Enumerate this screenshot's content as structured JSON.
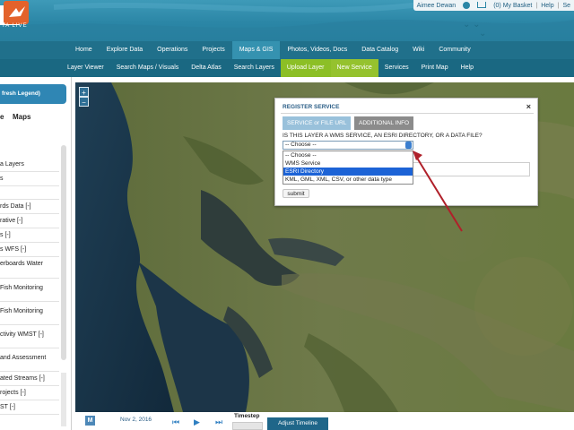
{
  "header": {
    "logo_text": "TA LIVE",
    "user_name": "Aimee Dewan",
    "basket_label": "(0) My Basket",
    "help_label": "Help",
    "search_label": "Se"
  },
  "nav_primary": [
    {
      "label": "Home"
    },
    {
      "label": "Explore Data"
    },
    {
      "label": "Operations"
    },
    {
      "label": "Projects"
    },
    {
      "label": "Maps & GIS"
    },
    {
      "label": "Photos, Videos, Docs"
    },
    {
      "label": "Data Catalog"
    },
    {
      "label": "Wiki"
    },
    {
      "label": "Community"
    }
  ],
  "nav_secondary": [
    {
      "label": "Layer Viewer"
    },
    {
      "label": "Search Maps / Visuals"
    },
    {
      "label": "Delta Atlas"
    },
    {
      "label": "Search Layers"
    },
    {
      "label": "Upload Layer"
    },
    {
      "label": "New Service"
    },
    {
      "label": "Services"
    },
    {
      "label": "Print Map"
    },
    {
      "label": "Help"
    }
  ],
  "sidebar": {
    "refresh_label": "fresh Legend)",
    "tab_e": "e",
    "tab_maps": "Maps",
    "layers": [
      "a Layers",
      "s",
      "",
      "rds Data [-]",
      "rative [-]",
      "s [-]",
      "s WFS [-]",
      "erboards Water",
      "Fish Monitoring",
      "Fish Monitoring",
      "ctivity WMST [-]",
      "and Assessment",
      "ated Streams [-]",
      "rojects [-]",
      "ST [-]"
    ]
  },
  "map": {
    "zoom_in": "+",
    "zoom_out": "−"
  },
  "dialog": {
    "title": "REGISTER SERVICE",
    "close": "×",
    "tab_service": "SERVICE or FILE URL",
    "tab_info": "ADDITIONAL INFO",
    "question": "IS THIS LAYER A WMS SERVICE, AN ESRI DIRECTORY, OR A DATA FILE?",
    "select_value": "-- Choose --",
    "options": [
      "-- Choose --",
      "WMS Service",
      "ESRI Directory",
      "KML, GML, XML, CSV, or other data type"
    ],
    "selected_option": "ESRI Directory",
    "submit_label": "submit"
  },
  "timeline": {
    "m_label": "M",
    "date": "Nov 2, 2016",
    "timestep_label": "Timestep",
    "adjust_label": "Adjust Timeline"
  },
  "colors": {
    "header_blue": "#2b86a6",
    "nav_dark": "#20708b",
    "upload_green": "#8cbf26",
    "annotation_arrow": "#b0202a",
    "option_highlight": "#1c63d6"
  }
}
